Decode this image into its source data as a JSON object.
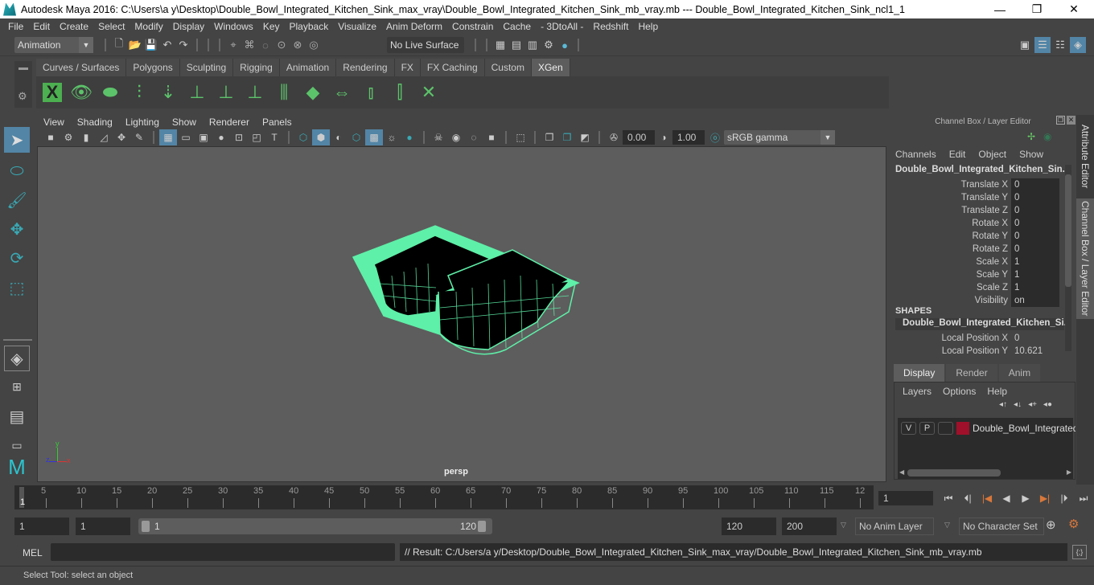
{
  "window": {
    "title": "Autodesk Maya 2016: C:\\Users\\a y\\Desktop\\Double_Bowl_Integrated_Kitchen_Sink_max_vray\\Double_Bowl_Integrated_Kitchen_Sink_mb_vray.mb  ---  Double_Bowl_Integrated_Kitchen_Sink_ncl1_1",
    "minimize": "—",
    "restore": "❐",
    "close": "✕"
  },
  "menubar": [
    "File",
    "Edit",
    "Create",
    "Select",
    "Modify",
    "Display",
    "Windows",
    "Key",
    "Playback",
    "Visualize",
    "Anim Deform",
    "Constrain",
    "Cache",
    "- 3DtoAll -",
    "Redshift",
    "Help"
  ],
  "statusline": {
    "menuset": "Animation",
    "live_surface": "No Live Surface"
  },
  "shelf": {
    "tabs": [
      "Curves / Surfaces",
      "Polygons",
      "Sculpting",
      "Rigging",
      "Animation",
      "Rendering",
      "FX",
      "FX Caching",
      "Custom",
      "XGen"
    ],
    "active_tab": "XGen",
    "icons": [
      "xgen-editor-icon",
      "preview-icon",
      "clear-preview-icon",
      "add-guides-icon",
      "place-guides-icon",
      "add-guide-icon",
      "guide-visibility-icon",
      "lock-guides-icon",
      "split-guides-icon",
      "groom-icon",
      "flip-guides-icon",
      "select-guides-icon",
      "bound-guides-icon",
      "delete-guides-icon"
    ]
  },
  "panel": {
    "menus": [
      "View",
      "Shading",
      "Lighting",
      "Show",
      "Renderer",
      "Panels"
    ],
    "exposure": "0.00",
    "gamma": "1.00",
    "color_space": "sRGB gamma",
    "camera_label": "persp"
  },
  "channelbox": {
    "header": "Channel Box / Layer Editor",
    "menus": [
      "Channels",
      "Edit",
      "Object",
      "Show"
    ],
    "object_name": "Double_Bowl_Integrated_Kitchen_Sin...",
    "channels": [
      {
        "label": "Translate X",
        "value": "0"
      },
      {
        "label": "Translate Y",
        "value": "0"
      },
      {
        "label": "Translate Z",
        "value": "0"
      },
      {
        "label": "Rotate X",
        "value": "0"
      },
      {
        "label": "Rotate Y",
        "value": "0"
      },
      {
        "label": "Rotate Z",
        "value": "0"
      },
      {
        "label": "Scale X",
        "value": "1"
      },
      {
        "label": "Scale Y",
        "value": "1"
      },
      {
        "label": "Scale Z",
        "value": "1"
      },
      {
        "label": "Visibility",
        "value": "on"
      }
    ],
    "shapes_label": "SHAPES",
    "shape_name": "Double_Bowl_Integrated_Kitchen_Si...",
    "shape_channels": [
      {
        "label": "Local Position X",
        "value": "0"
      },
      {
        "label": "Local Position Y",
        "value": "10.621"
      }
    ]
  },
  "layer_editor": {
    "tabs": [
      "Display",
      "Render",
      "Anim"
    ],
    "active_tab": "Display",
    "menus": [
      "Layers",
      "Options",
      "Help"
    ],
    "layers": [
      {
        "v": "V",
        "p": "P",
        "color": "#a0102a",
        "name": "Double_Bowl_Integrated"
      }
    ]
  },
  "side_tabs": [
    "Attribute Editor",
    "Channel Box / Layer Editor"
  ],
  "timeline": {
    "ticks": [
      "5",
      "10",
      "15",
      "20",
      "25",
      "30",
      "35",
      "40",
      "45",
      "50",
      "55",
      "60",
      "65",
      "70",
      "75",
      "80",
      "85",
      "90",
      "95",
      "100",
      "105",
      "110",
      "115",
      "12"
    ],
    "current_frame_marker": "1",
    "current_frame": "1"
  },
  "range": {
    "start": "1",
    "anim_start": "1",
    "slider_start": "1",
    "slider_end": "120",
    "anim_end": "120",
    "end": "200",
    "anim_layer": "No Anim Layer",
    "character_set": "No Character Set"
  },
  "mel": {
    "label": "MEL",
    "result": "// Result: C:/Users/a y/Desktop/Double_Bowl_Integrated_Kitchen_Sink_max_vray/Double_Bowl_Integrated_Kitchen_Sink_mb_vray.mb"
  },
  "help_line": "Select Tool: select an object",
  "colors": {
    "accent": "#5285a6",
    "wireframe": "#5ef0a8",
    "layer_color": "#a0102a",
    "key_marker": "#d9773a"
  }
}
